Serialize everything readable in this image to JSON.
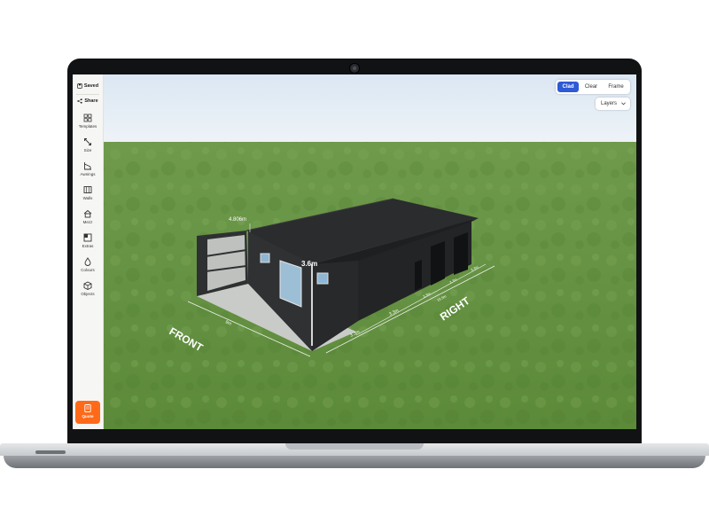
{
  "sidebar": {
    "saved_label": "Saved",
    "share_label": "Share",
    "items": [
      {
        "label": "Templates",
        "icon": "grid-icon"
      },
      {
        "label": "Size",
        "icon": "resize-arrows-icon"
      },
      {
        "label": "Awnings",
        "icon": "awning-icon"
      },
      {
        "label": "Walls",
        "icon": "wall-panel-icon"
      },
      {
        "label": "Mezz",
        "icon": "house-icon"
      },
      {
        "label": "Extras",
        "icon": "extras-icon"
      },
      {
        "label": "Colours",
        "icon": "droplet-icon"
      },
      {
        "label": "Objects",
        "icon": "cube-icon"
      }
    ],
    "quote_label": "Quote"
  },
  "view_toggle": {
    "options": [
      "Clad",
      "Clear",
      "Frame"
    ],
    "selected": "Clad"
  },
  "layers_label": "Layers",
  "dimensions": {
    "height": "4.806m",
    "eave": "3.6m",
    "awning_width": "9m",
    "front_label": "FRONT",
    "right_label": "RIGHT",
    "right_total": "16.5m",
    "bay_1": "3.3m",
    "bay_2": "3.3m",
    "bay_3": "3.3m",
    "bay_4": "3.3m",
    "bay_5": "3.3m"
  },
  "colors": {
    "accent": "#2e5ad6",
    "quote": "#ff6a1a",
    "cladding": "#2b2c2e",
    "grass": "#5e8c3c",
    "sky": "#dfeaf5"
  }
}
